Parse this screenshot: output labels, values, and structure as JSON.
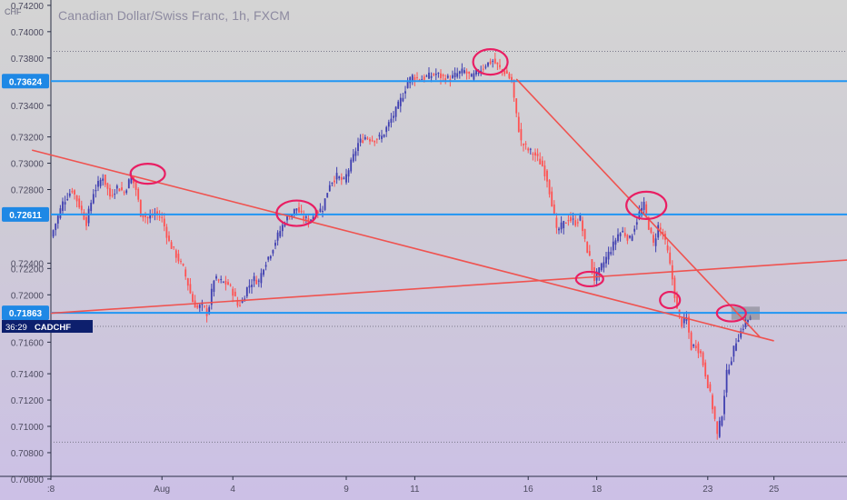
{
  "header": {
    "title": "Canadian Dollar/Swiss Franc, 1h, FXCM",
    "currency": "CHF"
  },
  "colors": {
    "level_line": "#2196f3",
    "trend_line": "#ef5350",
    "annotation": "#e91e63",
    "bull_candle": "#3f3fb0",
    "bear_candle": "#ff5252",
    "label_bg": "#1e88e5",
    "symbol_bg": "#0d1f6d"
  },
  "chart_data": {
    "type": "candlestick",
    "symbol": "CADCHF",
    "timeframe": "1h",
    "ylim": [
      0.7062,
      0.7422
    ],
    "y_ticks": [
      0.742,
      0.74,
      0.738,
      0.7344,
      0.732,
      0.73,
      0.728,
      0.7224,
      0.722,
      0.72,
      0.7164,
      0.714,
      0.712,
      0.71,
      0.708,
      0.706
    ],
    "y_tick_labels": [
      "0.74200",
      "0.74000",
      "0.73800",
      "0.73400",
      "0.73200",
      "0.73000",
      "0.72800",
      "0.72400",
      "0.72200",
      "0.72000",
      "0.71600",
      "0.71400",
      "0.71200",
      "0.71000",
      "0.70800",
      "0.70600"
    ],
    "x_ticks": [
      {
        "label": ":8",
        "bar": 0
      },
      {
        "label": "Aug",
        "bar": 47
      },
      {
        "label": "4",
        "bar": 77
      },
      {
        "label": "9",
        "bar": 125
      },
      {
        "label": "11",
        "bar": 154
      },
      {
        "label": "16",
        "bar": 202
      },
      {
        "label": "18",
        "bar": 231
      },
      {
        "label": "23",
        "bar": 278
      },
      {
        "label": "25",
        "bar": 306
      }
    ],
    "n_bars": 290,
    "anchors": [
      [
        0,
        0.7244
      ],
      [
        5,
        0.727
      ],
      [
        9,
        0.728
      ],
      [
        12,
        0.7268
      ],
      [
        15,
        0.7255
      ],
      [
        18,
        0.7278
      ],
      [
        22,
        0.729
      ],
      [
        25,
        0.7275
      ],
      [
        28,
        0.7282
      ],
      [
        31,
        0.7278
      ],
      [
        34,
        0.729
      ],
      [
        36,
        0.728
      ],
      [
        38,
        0.7262
      ],
      [
        41,
        0.7258
      ],
      [
        44,
        0.7262
      ],
      [
        47,
        0.7258
      ],
      [
        50,
        0.724
      ],
      [
        53,
        0.723
      ],
      [
        56,
        0.722
      ],
      [
        58,
        0.7208
      ],
      [
        60,
        0.7195
      ],
      [
        62,
        0.719
      ],
      [
        64,
        0.7192
      ],
      [
        66,
        0.7186
      ],
      [
        67,
        0.7192
      ],
      [
        69,
        0.7212
      ],
      [
        72,
        0.721
      ],
      [
        75,
        0.7208
      ],
      [
        77,
        0.7202
      ],
      [
        79,
        0.7192
      ],
      [
        81,
        0.7195
      ],
      [
        83,
        0.7205
      ],
      [
        86,
        0.7212
      ],
      [
        88,
        0.721
      ],
      [
        90,
        0.7222
      ],
      [
        93,
        0.7232
      ],
      [
        96,
        0.7245
      ],
      [
        99,
        0.7256
      ],
      [
        102,
        0.7262
      ],
      [
        104,
        0.7266
      ],
      [
        106,
        0.726
      ],
      [
        109,
        0.7256
      ],
      [
        112,
        0.7262
      ],
      [
        115,
        0.7266
      ],
      [
        118,
        0.7285
      ],
      [
        121,
        0.729
      ],
      [
        124,
        0.7286
      ],
      [
        127,
        0.73
      ],
      [
        130,
        0.7315
      ],
      [
        133,
        0.732
      ],
      [
        136,
        0.7318
      ],
      [
        140,
        0.732
      ],
      [
        143,
        0.733
      ],
      [
        146,
        0.734
      ],
      [
        149,
        0.7352
      ],
      [
        151,
        0.7362
      ],
      [
        153,
        0.7366
      ],
      [
        156,
        0.7364
      ],
      [
        160,
        0.7366
      ],
      [
        163,
        0.7368
      ],
      [
        166,
        0.7365
      ],
      [
        169,
        0.7364
      ],
      [
        172,
        0.7368
      ],
      [
        175,
        0.737
      ],
      [
        178,
        0.7365
      ],
      [
        181,
        0.737
      ],
      [
        184,
        0.7375
      ],
      [
        187,
        0.7378
      ],
      [
        190,
        0.7372
      ],
      [
        193,
        0.7368
      ],
      [
        195,
        0.7362
      ],
      [
        197,
        0.7336
      ],
      [
        199,
        0.7316
      ],
      [
        202,
        0.731
      ],
      [
        205,
        0.7306
      ],
      [
        208,
        0.7298
      ],
      [
        210,
        0.7288
      ],
      [
        212,
        0.727
      ],
      [
        214,
        0.7248
      ],
      [
        216,
        0.7252
      ],
      [
        219,
        0.7258
      ],
      [
        222,
        0.7255
      ],
      [
        224,
        0.7258
      ],
      [
        226,
        0.724
      ],
      [
        228,
        0.7228
      ],
      [
        230,
        0.7212
      ],
      [
        232,
        0.7218
      ],
      [
        235,
        0.7228
      ],
      [
        238,
        0.7238
      ],
      [
        240,
        0.7246
      ],
      [
        242,
        0.7248
      ],
      [
        245,
        0.7242
      ],
      [
        247,
        0.7252
      ],
      [
        249,
        0.7262
      ],
      [
        251,
        0.7268
      ],
      [
        253,
        0.7252
      ],
      [
        255,
        0.7238
      ],
      [
        257,
        0.7252
      ],
      [
        259,
        0.7246
      ],
      [
        261,
        0.7232
      ],
      [
        263,
        0.7212
      ],
      [
        265,
        0.7188
      ],
      [
        267,
        0.7178
      ],
      [
        269,
        0.7182
      ],
      [
        271,
        0.716
      ],
      [
        273,
        0.7162
      ],
      [
        275,
        0.7155
      ],
      [
        277,
        0.714
      ],
      [
        279,
        0.7124
      ],
      [
        281,
        0.7105
      ],
      [
        282,
        0.7093
      ],
      [
        284,
        0.711
      ],
      [
        286,
        0.714
      ],
      [
        288,
        0.7152
      ],
      [
        290,
        0.7165
      ],
      [
        292,
        0.7172
      ],
      [
        294,
        0.718
      ],
      [
        296,
        0.7182
      ]
    ],
    "horizontal_levels": [
      {
        "label": "0.73624",
        "value": 0.73624
      },
      {
        "label": "0.72611",
        "value": 0.72611
      },
      {
        "label": "0.71863",
        "value": 0.71863
      }
    ],
    "current": {
      "countdown": "36:29",
      "symbol": "CADCHF",
      "value": 0.7176
    },
    "trend_lines": [
      {
        "from": [
          -8,
          0.731
        ],
        "to": [
          306,
          0.7165
        ]
      },
      {
        "from": [
          0,
          0.7186
        ],
        "to": [
          350,
          0.7228
        ]
      },
      {
        "from": [
          197,
          0.7364
        ],
        "to": [
          300,
          0.7168
        ]
      }
    ],
    "annotations": [
      {
        "type": "ellipse",
        "center": [
          41,
          0.7292
        ]
      },
      {
        "type": "ellipse",
        "center": [
          104,
          0.7262
        ]
      },
      {
        "type": "ellipse",
        "center": [
          186,
          0.7377
        ]
      },
      {
        "type": "ellipse",
        "center": [
          252,
          0.7268
        ]
      },
      {
        "type": "ellipse",
        "center": [
          228,
          0.7212
        ]
      },
      {
        "type": "ellipse",
        "center": [
          262,
          0.7196
        ]
      },
      {
        "type": "ellipse",
        "center": [
          288,
          0.7186
        ]
      }
    ],
    "highlight_box": {
      "x_range": [
        288,
        300
      ],
      "y_range": [
        0.7181,
        0.7191
      ]
    },
    "grid": false,
    "legend": "none"
  }
}
